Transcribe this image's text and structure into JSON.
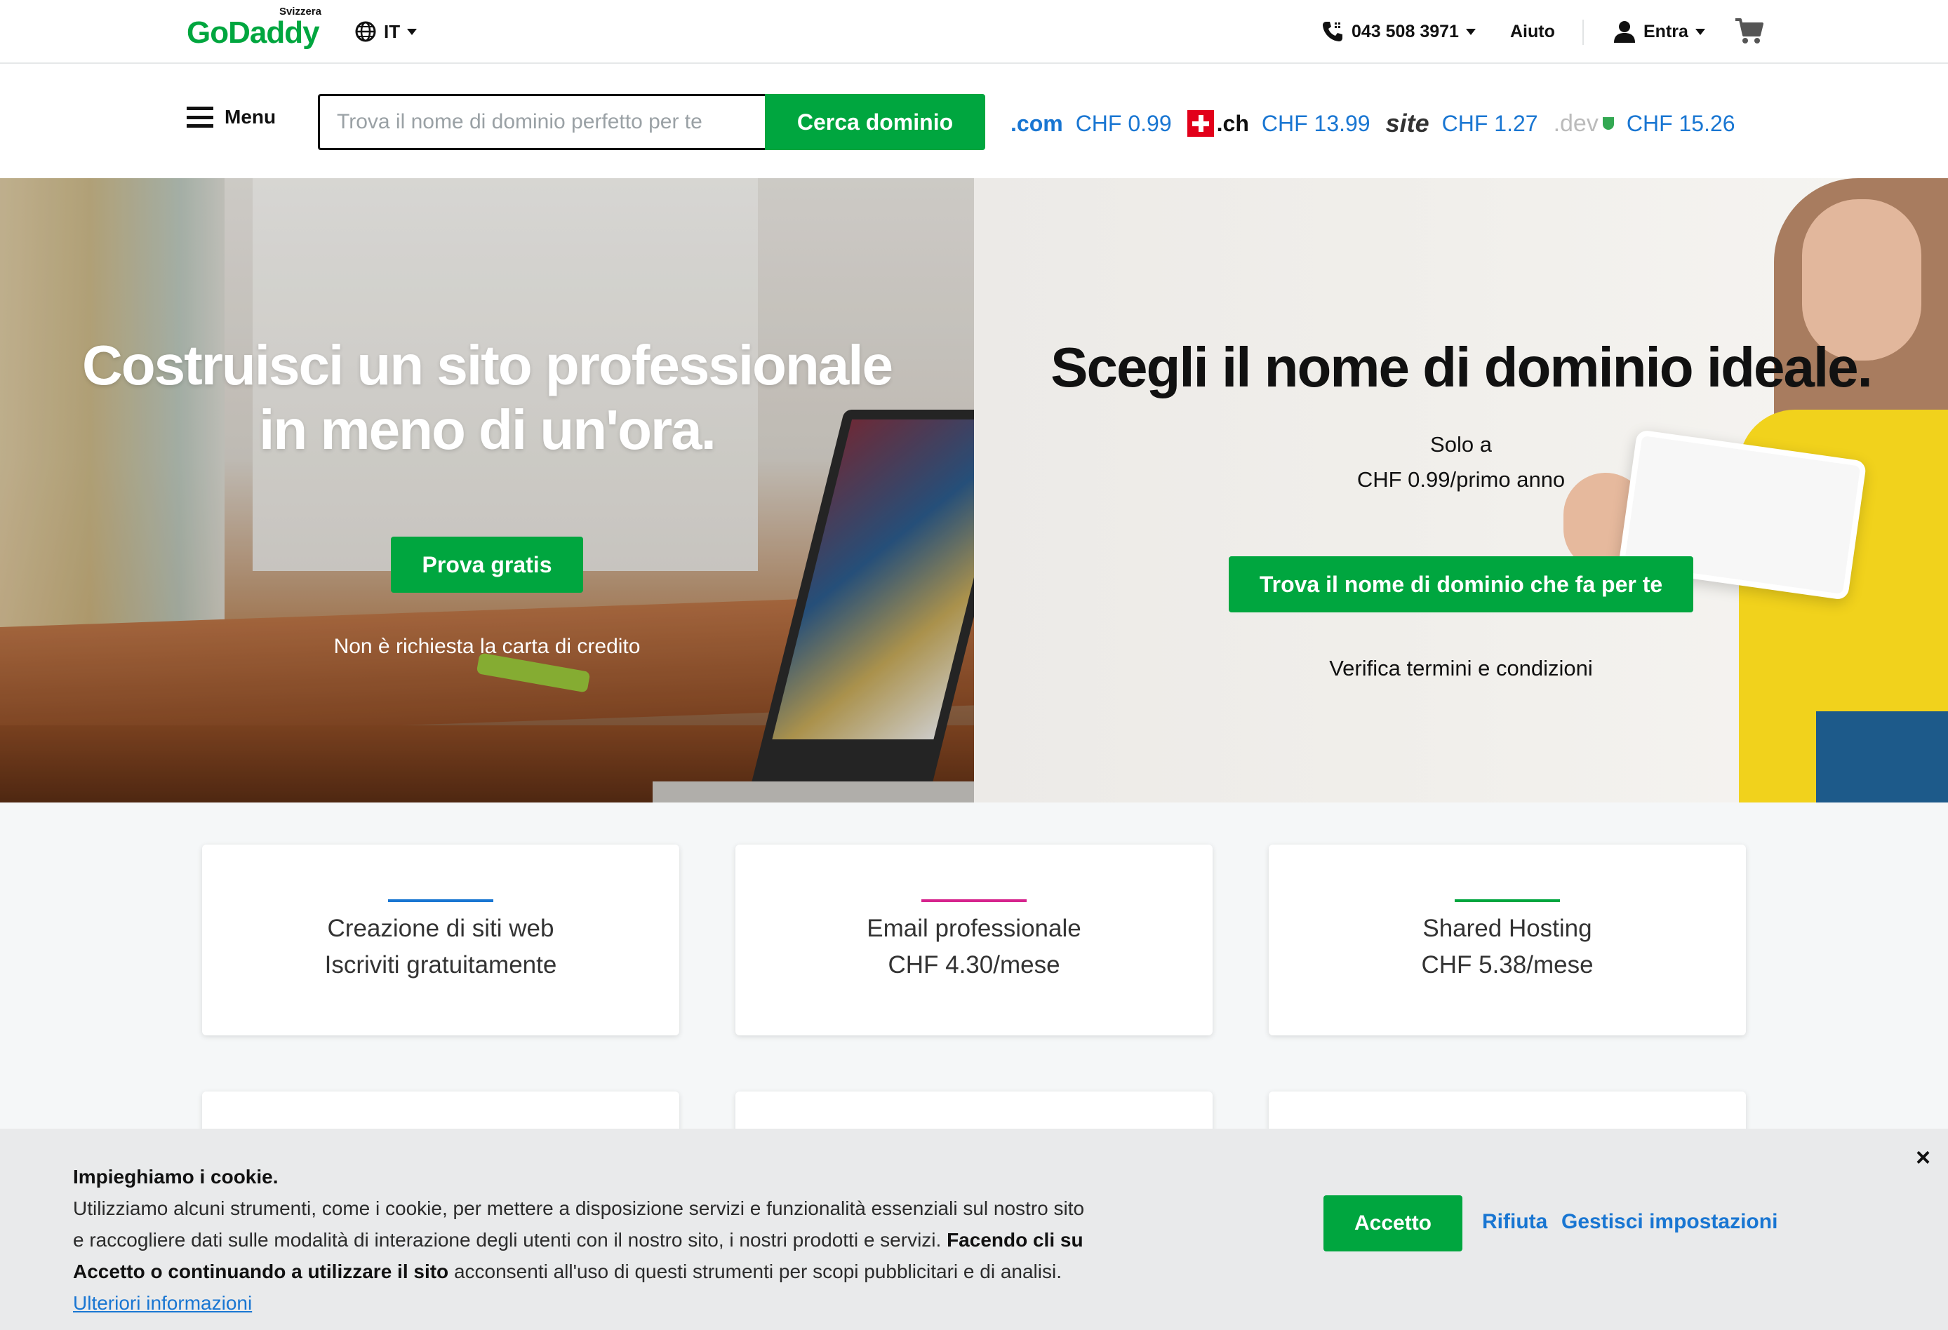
{
  "header": {
    "logo_country": "Svizzera",
    "logo_brand": "GoDaddy",
    "language": "IT",
    "phone": "043 508 3971",
    "help": "Aiuto",
    "signin": "Entra"
  },
  "nav": {
    "menu_label": "Menu",
    "search_placeholder": "Trova il nome di dominio perfetto per te",
    "search_button": "Cerca dominio",
    "tlds": [
      {
        "logo": ".com",
        "price": "CHF 0.99"
      },
      {
        "logo": ".ch",
        "price": "CHF 13.99"
      },
      {
        "logo": "site",
        "price": "CHF 1.27"
      },
      {
        "logo": ".dev",
        "price": "CHF 15.26"
      }
    ]
  },
  "hero": {
    "left_title_line1": "Costruisci un sito professionale",
    "left_title_line2": "in meno di un'ora.",
    "left_button": "Prova gratis",
    "left_note": "Non è richiesta la carta di credito",
    "right_title": "Scegli il nome di dominio ideale.",
    "right_sub1": "Solo a",
    "right_sub2": "CHF 0.99/primo anno",
    "right_button": "Trova il nome di dominio che fa per te",
    "right_note": "Verifica termini e condizioni"
  },
  "cards": [
    {
      "line1": "Creazione di siti web",
      "line2": "Iscriviti gratuitamente",
      "color": "#1976d2"
    },
    {
      "line1": "Email professionale",
      "line2": "CHF 4.30/mese",
      "color": "#d6248d"
    },
    {
      "line1": "Shared Hosting",
      "line2": "CHF 5.38/mese",
      "color": "#00a63f"
    }
  ],
  "cookie": {
    "title": "Impieghiamo i cookie.",
    "body1": "Utilizziamo alcuni strumenti, come i cookie, per mettere a disposizione servizi e funzionalità essenziali sul nostro sito",
    "body2": "e raccogliere dati sulle modalità di interazione degli utenti con il nostro sito, i nostri prodotti e servizi.",
    "bold": "Facendo cli su",
    "bold2": "Accetto o continuando a utilizzare il sito",
    "body3": "acconsenti all'uso di questi strumenti per scopi pubblicitari e di analisi.",
    "more_link": "Ulteriori informazioni",
    "accept": "Accetto",
    "reject": "Rifiuta",
    "manage": "Gestisci impostazioni",
    "close": "×"
  },
  "colors": {
    "brand_green": "#00a63f",
    "link_blue": "#1976d2"
  }
}
